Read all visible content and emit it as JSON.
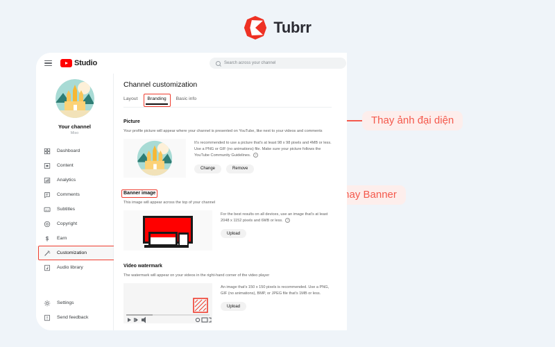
{
  "brand": {
    "name": "Tubrr",
    "logo_icon": "tubrr-logo-icon",
    "accent": "#ee3124"
  },
  "studio": {
    "topbar": {
      "menu_icon": "hamburger-menu-icon",
      "youtube_icon": "youtube-play-icon",
      "product_name": "Studio",
      "search": {
        "icon": "search-icon",
        "placeholder": "Search across your channel",
        "value": ""
      }
    },
    "sidebar": {
      "avatar_icon": "channel-avatar-icon",
      "channel_name": "Your channel",
      "channel_handle": "Miso",
      "items": [
        {
          "label": "Dashboard",
          "icon": "dashboard-icon",
          "active": false
        },
        {
          "label": "Content",
          "icon": "content-icon",
          "active": false
        },
        {
          "label": "Analytics",
          "icon": "analytics-icon",
          "active": false
        },
        {
          "label": "Comments",
          "icon": "comments-icon",
          "active": false
        },
        {
          "label": "Subtitles",
          "icon": "subtitles-icon",
          "active": false
        },
        {
          "label": "Copyright",
          "icon": "copyright-icon",
          "active": false
        },
        {
          "label": "Earn",
          "icon": "earn-dollar-icon",
          "active": false
        },
        {
          "label": "Customization",
          "icon": "customization-wand-icon",
          "active": true
        },
        {
          "label": "Audio library",
          "icon": "audio-library-icon",
          "active": false
        }
      ],
      "bottom_items": [
        {
          "label": "Settings",
          "icon": "gear-icon"
        },
        {
          "label": "Send feedback",
          "icon": "feedback-icon"
        }
      ]
    },
    "main": {
      "page_title": "Channel customization",
      "tabs": [
        {
          "label": "Layout",
          "active": false,
          "highlighted": false
        },
        {
          "label": "Branding",
          "active": true,
          "highlighted": true
        },
        {
          "label": "Basic info",
          "active": false,
          "highlighted": false
        }
      ],
      "sections": [
        {
          "title": "Picture",
          "highlighted": false,
          "subtitle": "Your profile picture will appear where your channel is presented on YouTube, like next to your videos and comments",
          "info": "It's recommended to use a picture that's at least 98 x 98 pixels and 4MB or less. Use a PNG or GIF (no animations) file. Make sure your picture follows the YouTube Community Guidelines.",
          "help_icon": "question-mark-icon",
          "buttons": [
            "Change",
            "Remove"
          ],
          "preview_icon": "profile-picture-preview"
        },
        {
          "title": "Banner image",
          "highlighted": true,
          "subtitle": "This image will appear across the top of your channel",
          "info": "For the best results on all devices, use an image that's at least 2048 x 1152 pixels and 6MB or less.",
          "help_icon": "question-mark-icon",
          "buttons": [
            "Upload"
          ],
          "preview_icon": "banner-devices-preview"
        },
        {
          "title": "Video watermark",
          "highlighted": false,
          "subtitle": "The watermark will appear on your videos in the right-hand corner of the video player",
          "info": "An image that's 150 x 150 pixels is recommended. Use a PNG, GIF (no animations), BMP, or JPEG file that's 1MB or less.",
          "help_icon": "",
          "buttons": [
            "Upload"
          ],
          "preview_icon": "video-watermark-preview"
        }
      ]
    }
  },
  "annotations": [
    {
      "text": "Thay ảnh đại diện",
      "color": "#f4594c",
      "bg": "#fdeeec"
    },
    {
      "text": "Thay Banner",
      "color": "#f4594c",
      "bg": "#fdeeec"
    }
  ]
}
